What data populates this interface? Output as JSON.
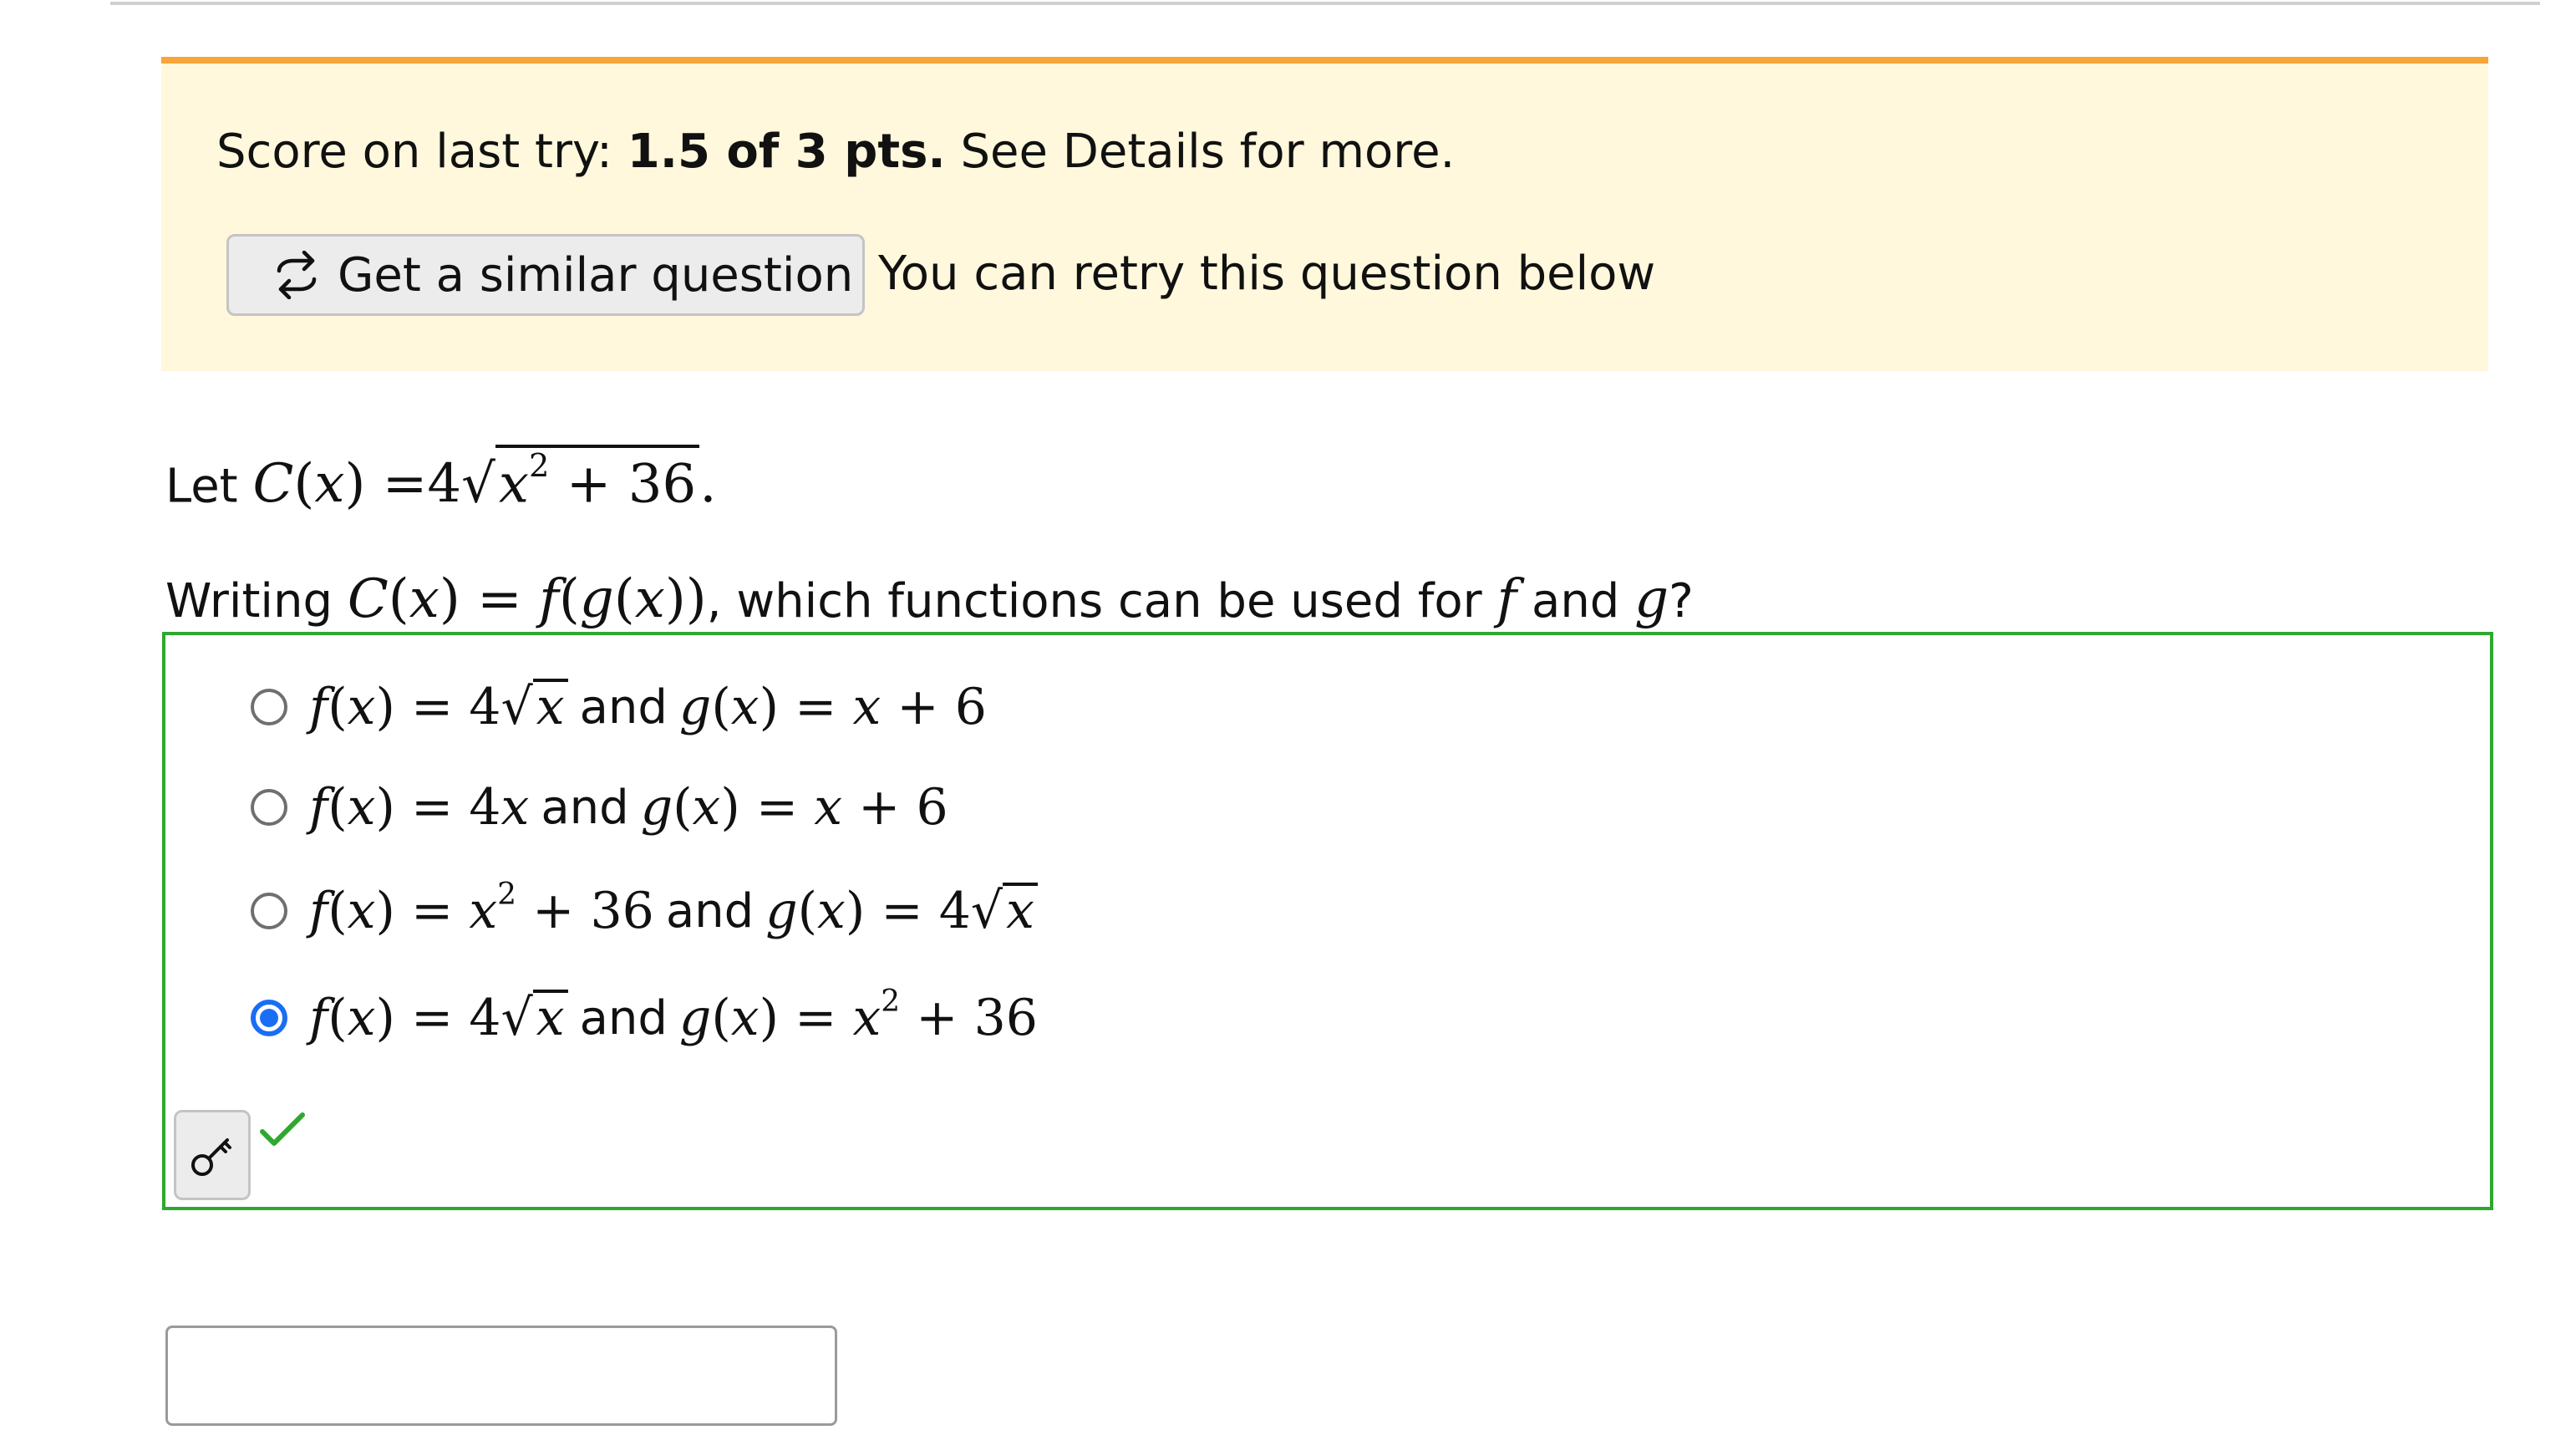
{
  "banner": {
    "score_prefix": "Score on last try: ",
    "score_value": "1.5 of 3 pts.",
    "score_suffix": " See Details for more.",
    "similar_button_label": "Get a similar question",
    "retry_text": "You can retry this question below"
  },
  "question": {
    "let_label": "Let",
    "writing_label": "Writing",
    "prompt_middle": ", which functions can be used for",
    "and_word": "and",
    "question_mark": "?"
  },
  "choices": [
    {
      "and_word": "and",
      "selected": false
    },
    {
      "and_word": "and",
      "selected": false
    },
    {
      "and_word": "and",
      "selected": false
    },
    {
      "and_word": "and",
      "selected": true
    }
  ],
  "answer_input": {
    "value": ""
  },
  "colors": {
    "banner_bg": "#fff8dc",
    "banner_accent": "#f7a43a",
    "correct_green": "#2ea82e",
    "radio_selected": "#1a6ef5"
  },
  "icons": [
    "retry-arrows-icon",
    "key-icon",
    "checkmark-icon"
  ]
}
